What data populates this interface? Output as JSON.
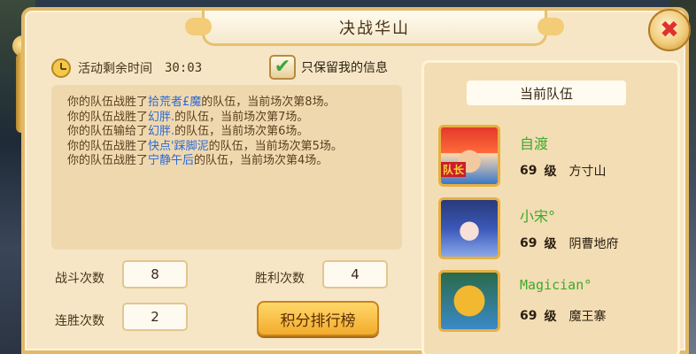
{
  "window": {
    "title": "决战华山"
  },
  "timer": {
    "label": "活动剩余时间",
    "value": "30:03"
  },
  "filter": {
    "label": "只保留我的信息",
    "checked": true
  },
  "log": [
    {
      "pre": "你的队伍战胜了",
      "name": "拾荒者£魔",
      "post": "的队伍，当前场次第8场。"
    },
    {
      "pre": "你的队伍战胜了",
      "name": "幻胖.",
      "post": "的队伍，当前场次第7场。"
    },
    {
      "pre": "你的队伍输给了",
      "name": "幻胖.",
      "post": "的队伍，当前场次第6场。"
    },
    {
      "pre": "你的队伍战胜了",
      "name": "快点'踩脚泥",
      "post": "的队伍，当前场次第5场。"
    },
    {
      "pre": "你的队伍战胜了",
      "name": "宁静午后",
      "post": "的队伍，当前场次第4场。"
    }
  ],
  "stats": {
    "battles_label": "战斗次数",
    "battles_value": "8",
    "wins_label": "胜利次数",
    "wins_value": "4",
    "streak_label": "连胜次数",
    "streak_value": "2"
  },
  "ranking_button": "积分排行榜",
  "team": {
    "header": "当前队伍",
    "captain_tag": "队长",
    "level_unit": "级",
    "members": [
      {
        "name": "自渡",
        "level": "69",
        "school": "方寸山",
        "avatar": "red-hair-avatar"
      },
      {
        "name": "小宋°",
        "level": "69",
        "school": "阴曹地府",
        "avatar": "blue-hair-avatar"
      },
      {
        "name": "Magician°",
        "level": "69",
        "school": "魔王寨",
        "avatar": "tiger-avatar"
      }
    ]
  },
  "colors": {
    "panel_bg": "#f6e6c6",
    "highlight_name": "#2a6ad8",
    "member_name": "#3caa2c",
    "close_x": "#e0322a"
  }
}
